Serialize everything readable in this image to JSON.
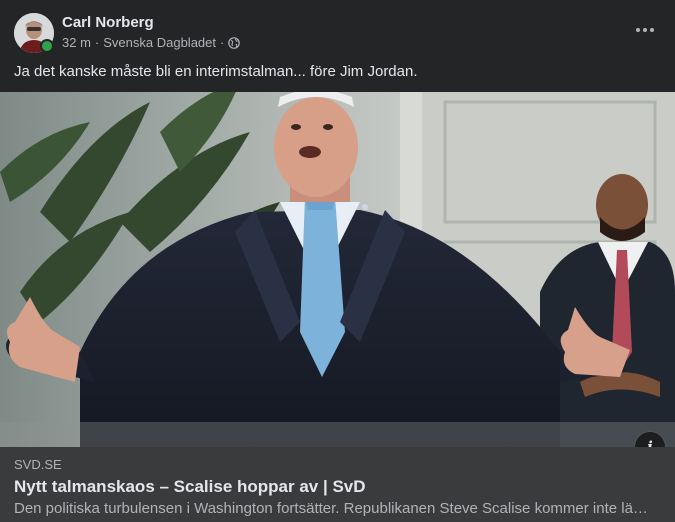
{
  "post": {
    "author": "Carl Norberg",
    "time": "32 m",
    "separator": "·",
    "source": "Svenska Dagbladet",
    "separator2": "·",
    "privacy_icon": "globe-icon",
    "text": "Ja det kanske måste bli en interimstalman... före Jim Jordan.",
    "more_icon": "more-options-icon"
  },
  "link_preview": {
    "domain": "SVD.SE",
    "title": "Nytt talmanskaos – Scalise hoppar av | SvD",
    "description": "Den politiska turbulensen i Washington fortsätter. Republikanen Steve Scalise kommer inte lä…",
    "info_label": "i"
  },
  "colors": {
    "background": "#242526",
    "footer": "#3a3b3c",
    "online": "#31a24c",
    "text_primary": "#e4e6eb",
    "text_secondary": "#b0b3b8"
  }
}
